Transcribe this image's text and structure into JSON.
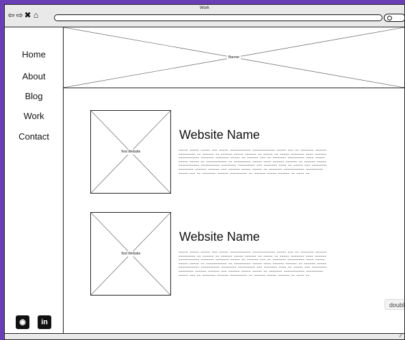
{
  "window": {
    "title": "Work"
  },
  "browser": {
    "back_icon": "back-arrow-icon",
    "forward_icon": "forward-arrow-icon",
    "close_icon": "close-icon",
    "home_icon": "home-icon",
    "back_glyph": "⇦",
    "forward_glyph": "⇨",
    "close_glyph": "✖",
    "home_glyph": "⌂"
  },
  "sidebar": {
    "items": [
      {
        "label": "Home"
      },
      {
        "label": "About"
      },
      {
        "label": "Blog"
      },
      {
        "label": "Work"
      },
      {
        "label": "Contact"
      }
    ],
    "social": [
      {
        "icon": "github-icon",
        "glyph": "◉"
      },
      {
        "icon": "linkedin-icon",
        "glyph": "in"
      }
    ]
  },
  "banner": {
    "label": "Banner"
  },
  "projects": [
    {
      "thumb_label": "Test Website",
      "title": "Website Name",
      "description": "~~~~~ ~~~~~ ~~~~~ ~~~ ~~~~~ ~~~~~~~~~~~ ~~~~~~~~~~~~ ~~~~~ ~~~ ~~ ~~~~~~~ ~~~~~~ ~~~~~~~~~ ~~ ~~~~~~ ~~ ~~~~~~ ~~~~~ ~~~~~~ ~~ ~~~~~ ~~ ~~~~~ ~~~~~~~ ~~~~ ~~~~~~ ~~~~~~~~~~~ ~~~~~~~ ~~~~~~~ ~~~~~ ~~ ~~~~~~ ~~~ ~~ ~~~~~~~ ~~~~~~~~~ ~~~~ ~~~~~ ~~~~~ ~~~~~ ~~ ~~~~~~~~~~~ ~~ ~~~~~~~~~ ~~~~~ ~~~~ ~~~~~~ ~~~~~~ ~~ ~~~~~~ ~~~~~ ~~~~~~~~~~~ ~~~~~~~~~~ ~~~~~~~~ ~~~~~~~~~ ~~~ ~~~~~~~ ~~~~ ~~ ~~~~~ ~~~ ~~~~~~~~ ~~~~~~~~ ~~~~~~ ~~~~~~ ~~~ ~~~~~~ ~~~~~ ~~~~~ ~~ ~~~~~~~ ~~~~~~~~~~~ ~~~~~~~~~ ~~~~~ ~~~ ~~ ~~~~~~~ ~~~~~~ ~~~~~~~~~ ~~ ~~~~~~ ~~~~~ ~~~~~~ ~~ ~~~~ ~~"
    },
    {
      "thumb_label": "Test Website",
      "title": "Website Name",
      "description": "~~~~~ ~~~~~ ~~~~~ ~~~ ~~~~~ ~~~~~~~~~~~ ~~~~~~~~~~~~ ~~~~~ ~~~ ~~ ~~~~~~~ ~~~~~~ ~~~~~~~~~ ~~ ~~~~~~ ~~ ~~~~~~ ~~~~~ ~~~~~~ ~~ ~~~~~ ~~ ~~~~~ ~~~~~~~ ~~~~ ~~~~~~ ~~~~~~~~~~~ ~~~~~~~ ~~~~~~~ ~~~~~ ~~ ~~~~~~ ~~~ ~~ ~~~~~~~ ~~~~~~~~~ ~~~~ ~~~~~ ~~~~~ ~~~~~ ~~ ~~~~~~~~~~~ ~~ ~~~~~~~~~ ~~~~~ ~~~~ ~~~~~~ ~~~~~~ ~~ ~~~~~~ ~~~~~ ~~~~~~~~~~~ ~~~~~~~~~~ ~~~~~~~~ ~~~~~~~~~ ~~~ ~~~~~~~ ~~~~ ~~ ~~~~~ ~~~ ~~~~~~~~ ~~~~~~~~ ~~~~~~ ~~~~~~ ~~~ ~~~~~~ ~~~~~ ~~~~~ ~~ ~~~~~~~ ~~~~~~~~~~~ ~~~~~~~~~ ~~~~~ ~~~ ~~ ~~~~~~~ ~~~~~~ ~~~~~~~~~ ~~ ~~~~~~ ~~~~~ ~~~~~~ ~~ ~~~~ ~~"
    }
  ],
  "tooltip": {
    "text": "double"
  },
  "colors": {
    "frame": "#6a3fb5",
    "chrome": "#e9e9e9",
    "ink": "#111111"
  }
}
